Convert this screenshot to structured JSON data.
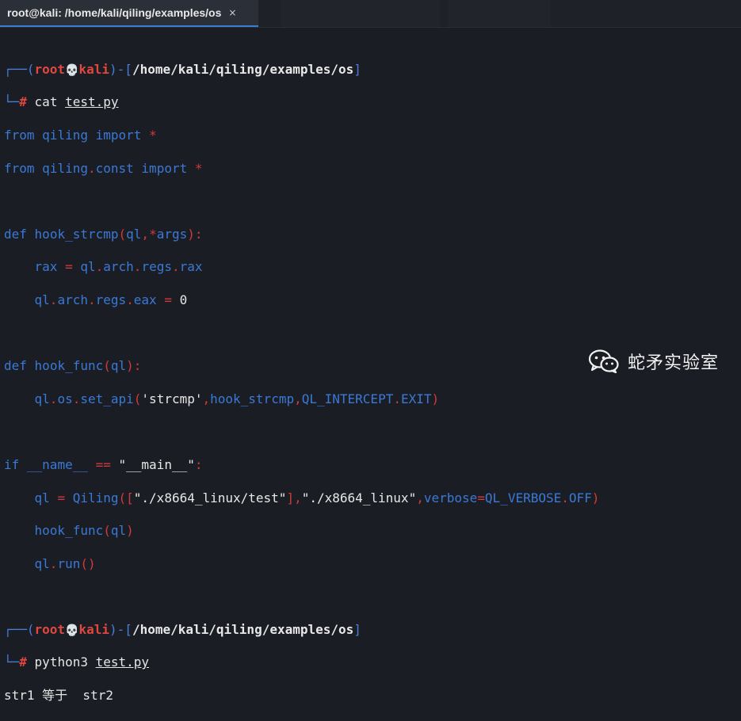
{
  "window": {
    "tab_title": "root@kali: /home/kali/qiling/examples/os",
    "tab_close": "×"
  },
  "prompt1": {
    "box_top": "┌──(",
    "user": "root",
    "skull": "💀",
    "host": "kali",
    "mid": ")-[",
    "path": "/home/kali/qiling/examples/os",
    "end": "]",
    "box_bottom": "└─",
    "hash": "#",
    "cmd": "cat",
    "arg": "test.py"
  },
  "code": {
    "l1_from": "from",
    "l1_mod": "qiling",
    "l1_import": "import",
    "l1_star": "*",
    "l2_from": "from",
    "l2_mod": "qiling",
    "l2_dot": ".",
    "l2_sub": "const",
    "l2_import": "import",
    "l2_star": "*",
    "l4_def": "def",
    "l4_name": "hook_strcmp",
    "l4_p1": "(",
    "l4_arg1": "ql",
    "l4_comma": ",",
    "l4_star": "*",
    "l4_arg2": "args",
    "l4_p2": "):",
    "l5_rax": "rax",
    "l5_eq": "=",
    "l5_ql": "ql",
    "l5_d1": ".",
    "l5_arch": "arch",
    "l5_d2": ".",
    "l5_regs": "regs",
    "l5_d3": ".",
    "l5_r": "rax",
    "l6_ql": "ql",
    "l6_d1": ".",
    "l6_arch": "arch",
    "l6_d2": ".",
    "l6_regs": "regs",
    "l6_d3": ".",
    "l6_eax": "eax",
    "l6_eq": "=",
    "l6_zero": "0",
    "l8_def": "def",
    "l8_name": "hook_func",
    "l8_p1": "(",
    "l8_arg": "ql",
    "l8_p2": "):",
    "l9_ql": "ql",
    "l9_d1": ".",
    "l9_os": "os",
    "l9_d2": ".",
    "l9_fn": "set_api",
    "l9_p1": "(",
    "l9_str": "'strcmp'",
    "l9_c1": ",",
    "l9_hook": "hook_strcmp",
    "l9_c2": ",",
    "l9_qi": "QL_INTERCEPT",
    "l9_d3": ".",
    "l9_exit": "EXIT",
    "l9_p2": ")",
    "l11_if": "if",
    "l11_name": "__name__",
    "l11_eq": "==",
    "l11_str": "\"__main__\"",
    "l11_colon": ":",
    "l12_ql": "ql",
    "l12_eq": "=",
    "l12_cls": "Qiling",
    "l12_p1": "([",
    "l12_s1": "\"./x8664_linux/test\"",
    "l12_b2": "],",
    "l12_s2": "\"./x8664_linux\"",
    "l12_c": ",",
    "l12_kw": "verbose",
    "l12_eq2": "=",
    "l12_vb": "QL_VERBOSE",
    "l12_d": ".",
    "l12_off": "OFF",
    "l12_p2": ")",
    "l13_fn": "hook_func",
    "l13_p1": "(",
    "l13_arg": "ql",
    "l13_p2": ")",
    "l14_ql": "ql",
    "l14_d": ".",
    "l14_run": "run",
    "l14_p": "()"
  },
  "prompt2": {
    "box_top": "┌──(",
    "user": "root",
    "skull": "💀",
    "host": "kali",
    "mid": ")-[",
    "path": "/home/kali/qiling/examples/os",
    "end": "]",
    "box_bottom": "└─",
    "hash": "#",
    "cmd": "python3",
    "arg": "test.py"
  },
  "output": {
    "line1": "str1 等于  str2"
  },
  "watermark": {
    "text": "蛇矛实验室",
    "icon": "wechat-icon"
  },
  "colors": {
    "background": "#1a1d23",
    "prompt_blue": "#4a7dd9",
    "prompt_red": "#e0473f",
    "keyword_blue": "#3b79d6",
    "operator_red": "#d23a3a",
    "tab_accent": "#3b7fd4"
  }
}
